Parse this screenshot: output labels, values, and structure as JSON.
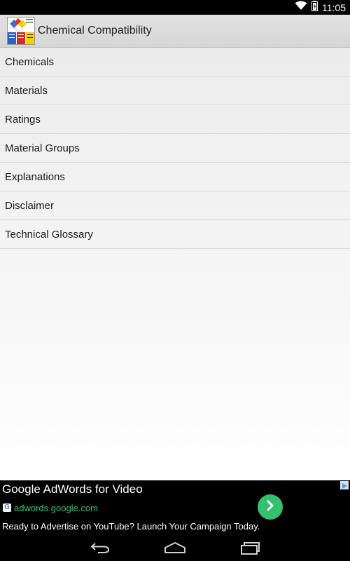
{
  "status_bar": {
    "time": "11:05",
    "icons": [
      "wifi-icon",
      "battery-icon"
    ]
  },
  "action_bar": {
    "title": "Chemical Compatibility",
    "logo_icon": "nfpa-diamond-logo"
  },
  "menu": {
    "items": [
      {
        "label": "Chemicals"
      },
      {
        "label": "Materials"
      },
      {
        "label": "Ratings"
      },
      {
        "label": "Material Groups"
      },
      {
        "label": "Explanations"
      },
      {
        "label": "Disclaimer"
      },
      {
        "label": "Technical Glossary"
      }
    ]
  },
  "ad": {
    "title": "Google AdWords for Video",
    "url": "adwords.google.com",
    "description": "Ready to Advertise on YouTube? Launch Your Campaign Today.",
    "g_icon_letter": "G",
    "accent_color": "#33c170"
  },
  "nav_bar": {
    "buttons": [
      "back-icon",
      "home-icon",
      "recent-apps-icon"
    ]
  }
}
